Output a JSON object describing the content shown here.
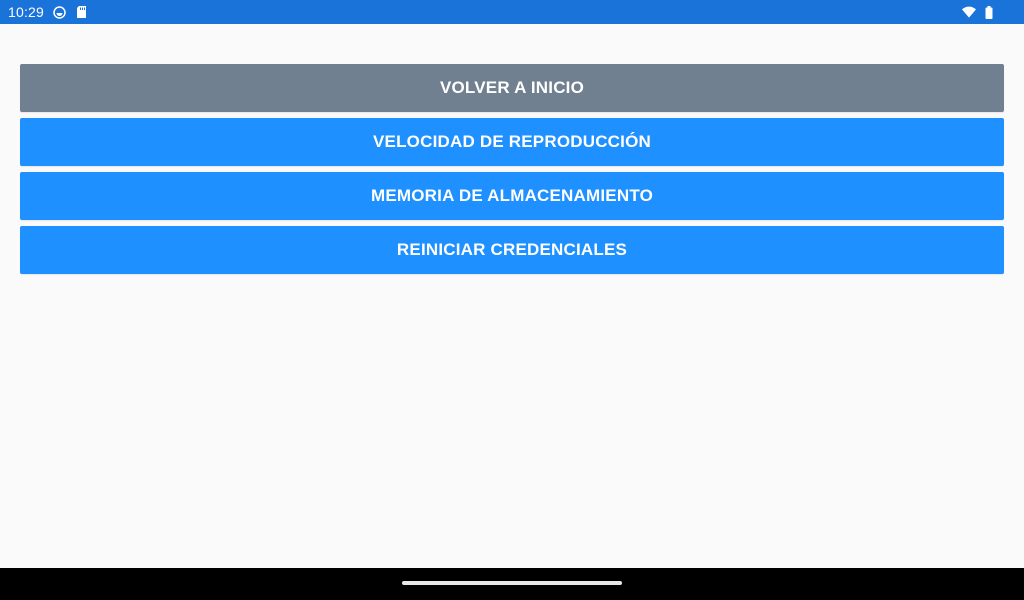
{
  "status_bar": {
    "time": "10:29",
    "icons_left": [
      "sync-circle-icon",
      "sd-card-icon"
    ],
    "icons_right": [
      "wifi-icon",
      "battery-icon"
    ],
    "color": "#1a73d9"
  },
  "menu": {
    "buttons": [
      {
        "label": "VOLVER A INICIO",
        "color": "#708090"
      },
      {
        "label": "VELOCIDAD DE REPRODUCCIÓN",
        "color": "#1e90ff"
      },
      {
        "label": "MEMORIA DE ALMACENAMIENTO",
        "color": "#1e90ff"
      },
      {
        "label": "REINICIAR CREDENCIALES",
        "color": "#1e90ff"
      }
    ]
  },
  "navigation": {
    "home_handle_icon": "home-gesture-bar"
  }
}
